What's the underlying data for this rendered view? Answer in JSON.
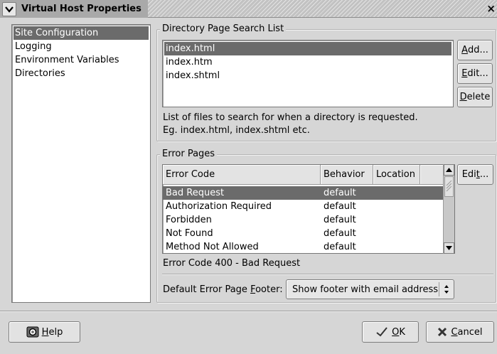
{
  "window": {
    "title": "Virtual Host Properties",
    "close_glyph": "×"
  },
  "sidebar": {
    "items": [
      {
        "label": "Site Configuration",
        "selected": true
      },
      {
        "label": "Logging"
      },
      {
        "label": "Environment Variables"
      },
      {
        "label": "Directories"
      }
    ]
  },
  "directory_search": {
    "frame_label": "Directory Page Search List",
    "items": [
      "index.html",
      "index.htm",
      "index.shtml"
    ],
    "selected_index": 0,
    "add_pre": "",
    "add_u": "A",
    "add_post": "dd...",
    "edit_pre": "",
    "edit_u": "E",
    "edit_post": "dit...",
    "delete_pre": "",
    "delete_u": "D",
    "delete_post": "elete",
    "description_line1": "List of files to search for when a directory is requested.",
    "description_line2": "Eg. index.html, index.shtml etc."
  },
  "error_pages": {
    "frame_label": "Error Pages",
    "columns": [
      "Error Code",
      "Behavior",
      "Location"
    ],
    "rows": [
      {
        "code": "Bad Request",
        "behavior": "default"
      },
      {
        "code": "Authorization Required",
        "behavior": "default"
      },
      {
        "code": "Forbidden",
        "behavior": "default"
      },
      {
        "code": "Not Found",
        "behavior": "default"
      },
      {
        "code": "Method Not Allowed",
        "behavior": "default"
      }
    ],
    "selected_index": 0,
    "edit_pre": "Edi",
    "edit_u": "t",
    "edit_post": "...",
    "status_text": "Error Code 400 - Bad Request",
    "footer_label_pre": "Default Error Page ",
    "footer_label_u": "F",
    "footer_label_post": "ooter:",
    "footer_value": "Show footer with email address"
  },
  "footer_buttons": {
    "help_u": "H",
    "help_post": "elp",
    "ok_u": "O",
    "ok_post": "K",
    "cancel_u": "C",
    "cancel_post": "ancel"
  }
}
